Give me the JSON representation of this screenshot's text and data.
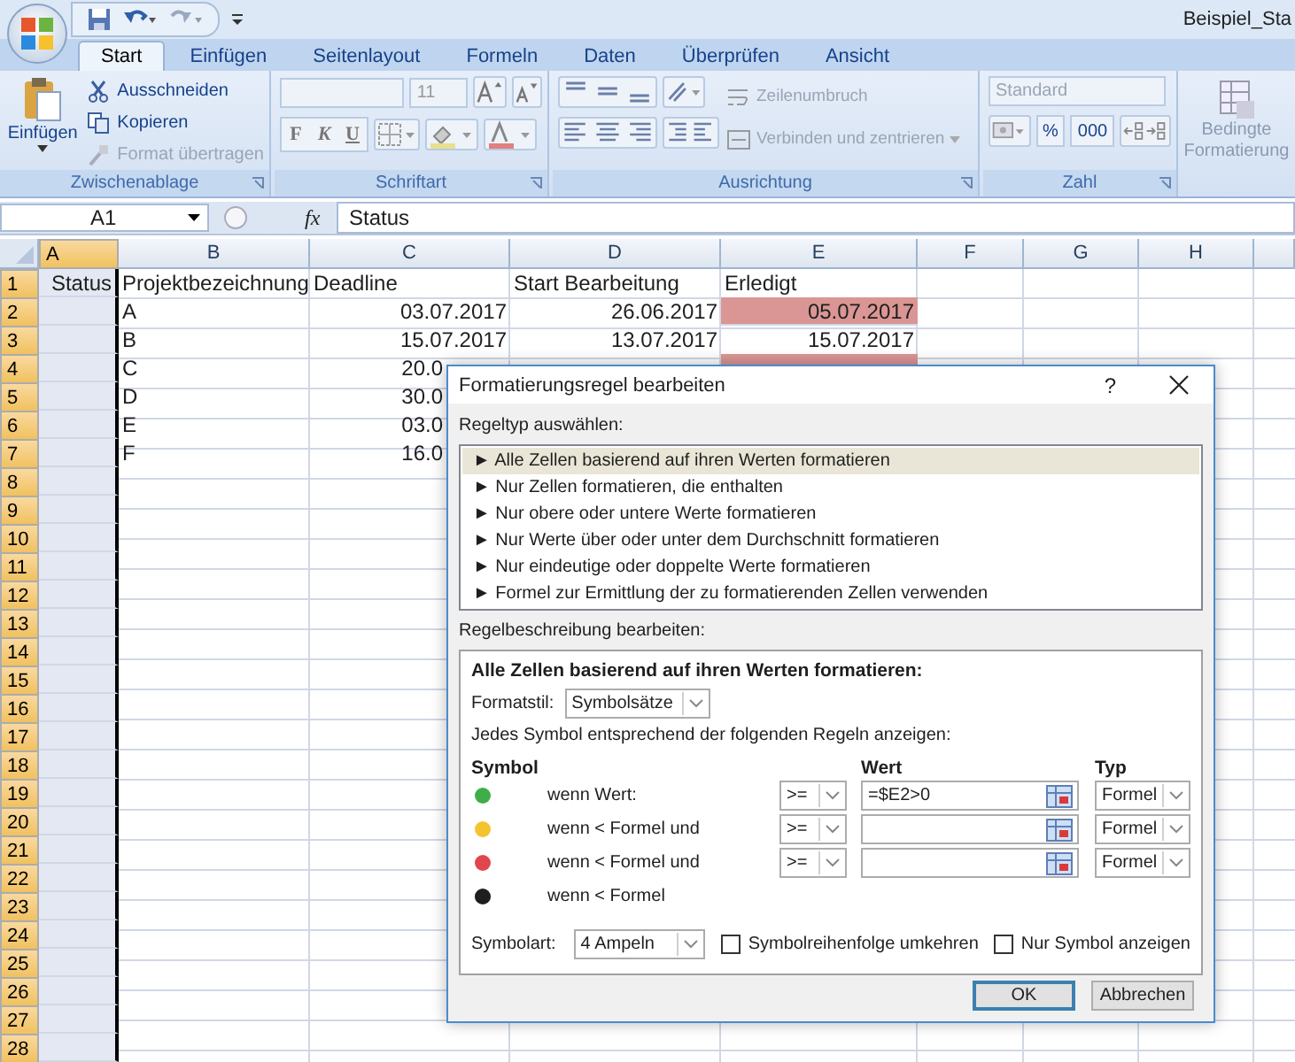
{
  "title_bar": {
    "title": "Beispiel_Sta"
  },
  "ribbon": {
    "tabs": [
      {
        "label": "Start",
        "selected": true
      },
      {
        "label": "Einfügen",
        "selected": false
      },
      {
        "label": "Seitenlayout",
        "selected": false
      },
      {
        "label": "Formeln",
        "selected": false
      },
      {
        "label": "Daten",
        "selected": false
      },
      {
        "label": "Überprüfen",
        "selected": false
      },
      {
        "label": "Ansicht",
        "selected": false
      }
    ],
    "clipboard": {
      "label": "Zwischenablage",
      "paste": "Einfügen",
      "items": [
        {
          "kind": "cut",
          "label": "Ausschneiden",
          "disabled": false
        },
        {
          "kind": "copy",
          "label": "Kopieren",
          "disabled": false
        },
        {
          "kind": "brush",
          "label": "Format übertragen",
          "disabled": true
        }
      ]
    },
    "font": {
      "label": "Schriftart",
      "size": "11",
      "styles": [
        "F",
        "K",
        "U"
      ]
    },
    "alignment": {
      "label": "Ausrichtung",
      "wrap": {
        "label": "Zeilenumbruch",
        "disabled": true
      },
      "merge": {
        "label": "Verbinden und zentrieren",
        "disabled": true
      }
    },
    "number": {
      "label": "Zahl",
      "format": {
        "label": "Standard",
        "disabled": true
      },
      "percent": "%",
      "thousands": "000"
    },
    "conditional": {
      "label": "Bedingte Formatierung",
      "disabled": true
    }
  },
  "formula_bar": {
    "name_box": "A1",
    "fx": "fx",
    "value": "Status"
  },
  "sheet": {
    "columns": [
      {
        "label": "A",
        "selected": true
      },
      {
        "label": "B",
        "selected": false
      },
      {
        "label": "C",
        "selected": false
      },
      {
        "label": "D",
        "selected": false
      },
      {
        "label": "E",
        "selected": false
      },
      {
        "label": "F",
        "selected": false
      },
      {
        "label": "G",
        "selected": false
      },
      {
        "label": "H",
        "selected": false
      }
    ],
    "rows": [
      {
        "label": "1",
        "selected": true,
        "cells": [
          {
            "value": "Status"
          },
          {
            "value": "Projektbezeichnung"
          },
          {
            "value": "Deadline"
          },
          {
            "value": "Start Bearbeitung"
          },
          {
            "value": "Erledigt",
            "highlighted": false
          }
        ]
      },
      {
        "label": "2",
        "selected": true,
        "cells": [
          {},
          {
            "value": "A"
          },
          {
            "value": "03.07.2017"
          },
          {
            "value": "26.06.2017"
          },
          {
            "value": "05.07.2017",
            "highlighted": true
          }
        ]
      },
      {
        "label": "3",
        "selected": true,
        "cells": [
          {},
          {
            "value": "B"
          },
          {
            "value": "15.07.2017"
          },
          {
            "value": "13.07.2017"
          },
          {
            "value": "15.07.2017",
            "highlighted": false
          }
        ]
      },
      {
        "label": "4",
        "selected": true,
        "cells": [
          {},
          {
            "value": "C"
          },
          {
            "value": "20.0",
            "covered": true
          },
          {},
          {
            "highlighted": true
          }
        ]
      },
      {
        "label": "5",
        "selected": true,
        "cells": [
          {},
          {
            "value": "D"
          },
          {
            "value": "30.0",
            "covered": true
          }
        ]
      },
      {
        "label": "6",
        "selected": true,
        "cells": [
          {},
          {
            "value": "E"
          },
          {
            "value": "03.0",
            "covered": true
          }
        ]
      },
      {
        "label": "7",
        "selected": true,
        "cells": [
          {},
          {
            "value": "F"
          },
          {
            "value": "16.0",
            "covered": true
          }
        ]
      },
      {
        "label": "8",
        "selected": true
      },
      {
        "label": "9",
        "selected": true
      },
      {
        "label": "10",
        "selected": true
      },
      {
        "label": "11",
        "selected": true
      },
      {
        "label": "12",
        "selected": true
      },
      {
        "label": "13",
        "selected": true
      },
      {
        "label": "14",
        "selected": true
      },
      {
        "label": "15",
        "selected": true
      },
      {
        "label": "16",
        "selected": true
      },
      {
        "label": "17",
        "selected": true
      },
      {
        "label": "18",
        "selected": true
      },
      {
        "label": "19",
        "selected": true
      },
      {
        "label": "20",
        "selected": true
      },
      {
        "label": "21",
        "selected": true
      },
      {
        "label": "22",
        "selected": true
      },
      {
        "label": "23",
        "selected": true
      },
      {
        "label": "24",
        "selected": true
      },
      {
        "label": "25",
        "selected": true
      },
      {
        "label": "26",
        "selected": true
      },
      {
        "label": "27",
        "selected": true
      },
      {
        "label": "28",
        "selected": true
      }
    ]
  },
  "dialog": {
    "title": "Formatierungsregel bearbeiten",
    "help": "?",
    "rule_type_label": "Regeltyp auswählen:",
    "rule_types": [
      {
        "label": "► Alle Zellen basierend auf ihren Werten formatieren",
        "selected": true
      },
      {
        "label": "► Nur Zellen formatieren, die enthalten",
        "selected": false
      },
      {
        "label": "► Nur obere oder untere Werte formatieren",
        "selected": false
      },
      {
        "label": "► Nur Werte über oder unter dem Durchschnitt formatieren",
        "selected": false
      },
      {
        "label": "► Nur eindeutige oder doppelte Werte formatieren",
        "selected": false
      },
      {
        "label": "► Formel zur Ermittlung der zu formatierenden Zellen verwenden",
        "selected": false
      }
    ],
    "description_label": "Regelbeschreibung bearbeiten:",
    "description": {
      "heading": "Alle Zellen basierend auf ihren Werten formatieren:",
      "format_style_label": "Formatstil:",
      "format_style": "Symbolsätze",
      "instruction": "Jedes Symbol entsprechend der folgenden Regeln anzeigen:",
      "columns": [
        "Symbol",
        "Wert",
        "Typ"
      ],
      "rules": [
        {
          "color": "#3fae49",
          "condition": "wenn Wert:",
          "operator": ">=",
          "value": "=$E2>0",
          "type": "Formel"
        },
        {
          "color": "#f4c430",
          "condition": "wenn < Formel und",
          "operator": ">=",
          "type": "Formel"
        },
        {
          "color": "#e0474c",
          "condition": "wenn < Formel und",
          "operator": ">=",
          "type": "Formel"
        },
        {
          "color": "#1e1e1e",
          "condition": "wenn < Formel"
        }
      ],
      "icon_style_label": "Symbolart:",
      "icon_style": "4 Ampeln",
      "options": [
        {
          "label": "Symbolreihenfolge umkehren",
          "checked": false
        },
        {
          "label": "Nur Symbol anzeigen",
          "checked": false
        }
      ]
    },
    "buttons": [
      {
        "label": "OK",
        "default": true
      },
      {
        "label": "Abbrechen",
        "default": false
      }
    ]
  }
}
